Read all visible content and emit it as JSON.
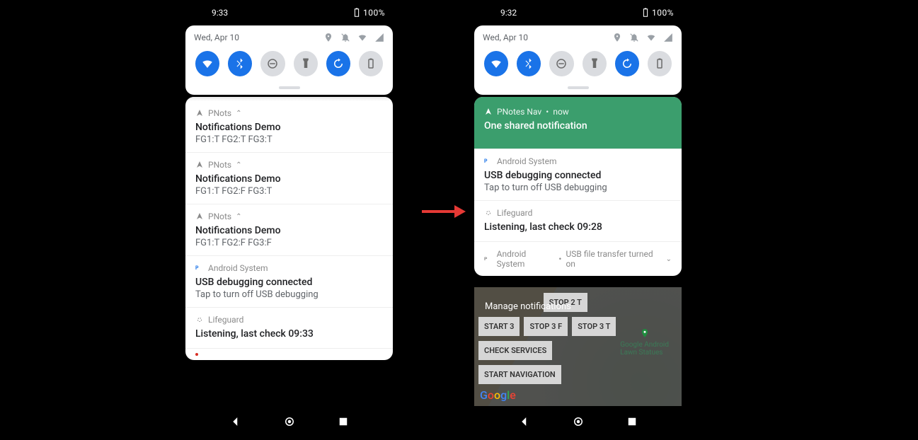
{
  "left": {
    "status": {
      "time": "9:33",
      "battery": "100%"
    },
    "qs": {
      "date": "Wed, Apr 10"
    },
    "notifs": [
      {
        "app": "PNots",
        "caret": true,
        "title": "Notifications Demo",
        "text": "FG1:T FG2:T FG3:T",
        "icon": "nav"
      },
      {
        "app": "PNots",
        "caret": true,
        "title": "Notifications Demo",
        "text": "FG1:T FG2:F FG3:T",
        "icon": "nav"
      },
      {
        "app": "PNots",
        "caret": true,
        "title": "Notifications Demo",
        "text": "FG1:T FG2:F FG3:F",
        "icon": "nav"
      },
      {
        "app": "Android System",
        "title": "USB debugging connected",
        "text": "Tap to turn off USB debugging",
        "icon": "p"
      },
      {
        "app": "Lifeguard",
        "title": "Listening, last check 09:33",
        "icon": "ring"
      }
    ]
  },
  "right": {
    "status": {
      "time": "9:32",
      "battery": "100%"
    },
    "qs": {
      "date": "Wed, Apr 10"
    },
    "notifs": [
      {
        "app": "PNotes Nav",
        "meta": "now",
        "title": "One shared notification",
        "highlight": true,
        "icon": "nav"
      },
      {
        "app": "Android System",
        "title": "USB debugging connected",
        "text": "Tap to turn off USB debugging",
        "icon": "p"
      },
      {
        "app": "Lifeguard",
        "title": "Listening, last check 09:28",
        "icon": "ring"
      },
      {
        "app": "Android System",
        "meta": "USB file transfer turned on",
        "collapsed": true,
        "icon": "p"
      }
    ],
    "manage": "Manage notifications",
    "bg_buttons": [
      "STOP 2 T",
      "START 3",
      "STOP 3 F",
      "STOP 3 T",
      "CHECK SERVICES",
      "START NAVIGATION"
    ],
    "poi": "Google Android\nLawn Statues",
    "google": "Google"
  }
}
